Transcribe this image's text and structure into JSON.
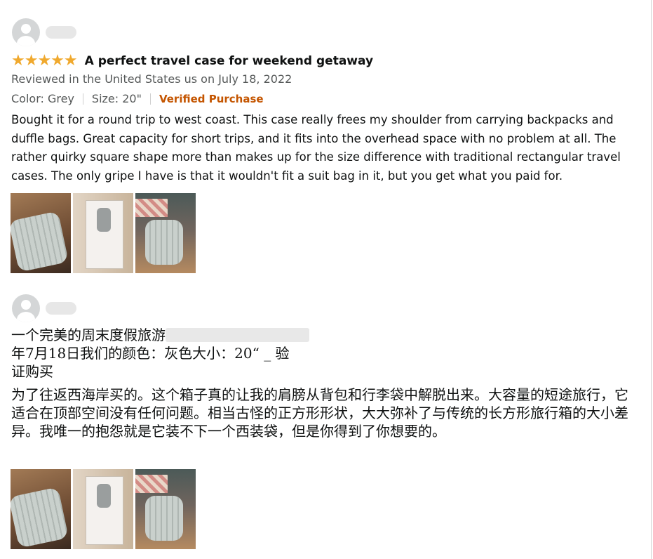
{
  "reviews": [
    {
      "stars": "★★★★★",
      "title": "A perfect travel case for weekend getaway",
      "reviewed_in": "Reviewed in the United States us on July 18, 2022",
      "color": "Color: Grey",
      "size": "Size: 20\"",
      "verified": "Verified Purchase",
      "body": "Bought it for a round trip to west coast. This case really frees my shoulder from carrying backpacks and duffle bags. Great capacity for short trips, and it fits into the overhead space with no problem at all. The rather quirky square shape more than makes up for the size difference with traditional rectangular travel cases. The only gripe I have is that it wouldn't fit a suit bag in it, but you get what you paid for."
    },
    {
      "title_line1": "一个完美的周末度假旅游",
      "title_line2": "年7月18日我们的颜色：灰色大小：20“ _ 验",
      "title_line3": "证购买",
      "body": "为了往返西海岸买的。这个箱子真的让我的肩膀从背包和行李袋中解脱出来。大容量的短途旅行，它适合在顶部空间没有任何问题。相当古怪的正方形形状，大大弥补了与传统的长方形旅行箱的大小差异。我唯一的抱怨就是它装不下一个西装袋，但是你得到了你想要的。"
    }
  ],
  "colors": {
    "star": "#f0a92e",
    "verified": "#c45500",
    "meta": "#565959"
  },
  "icons": [
    "avatar-placeholder-icon",
    "star-icon"
  ]
}
